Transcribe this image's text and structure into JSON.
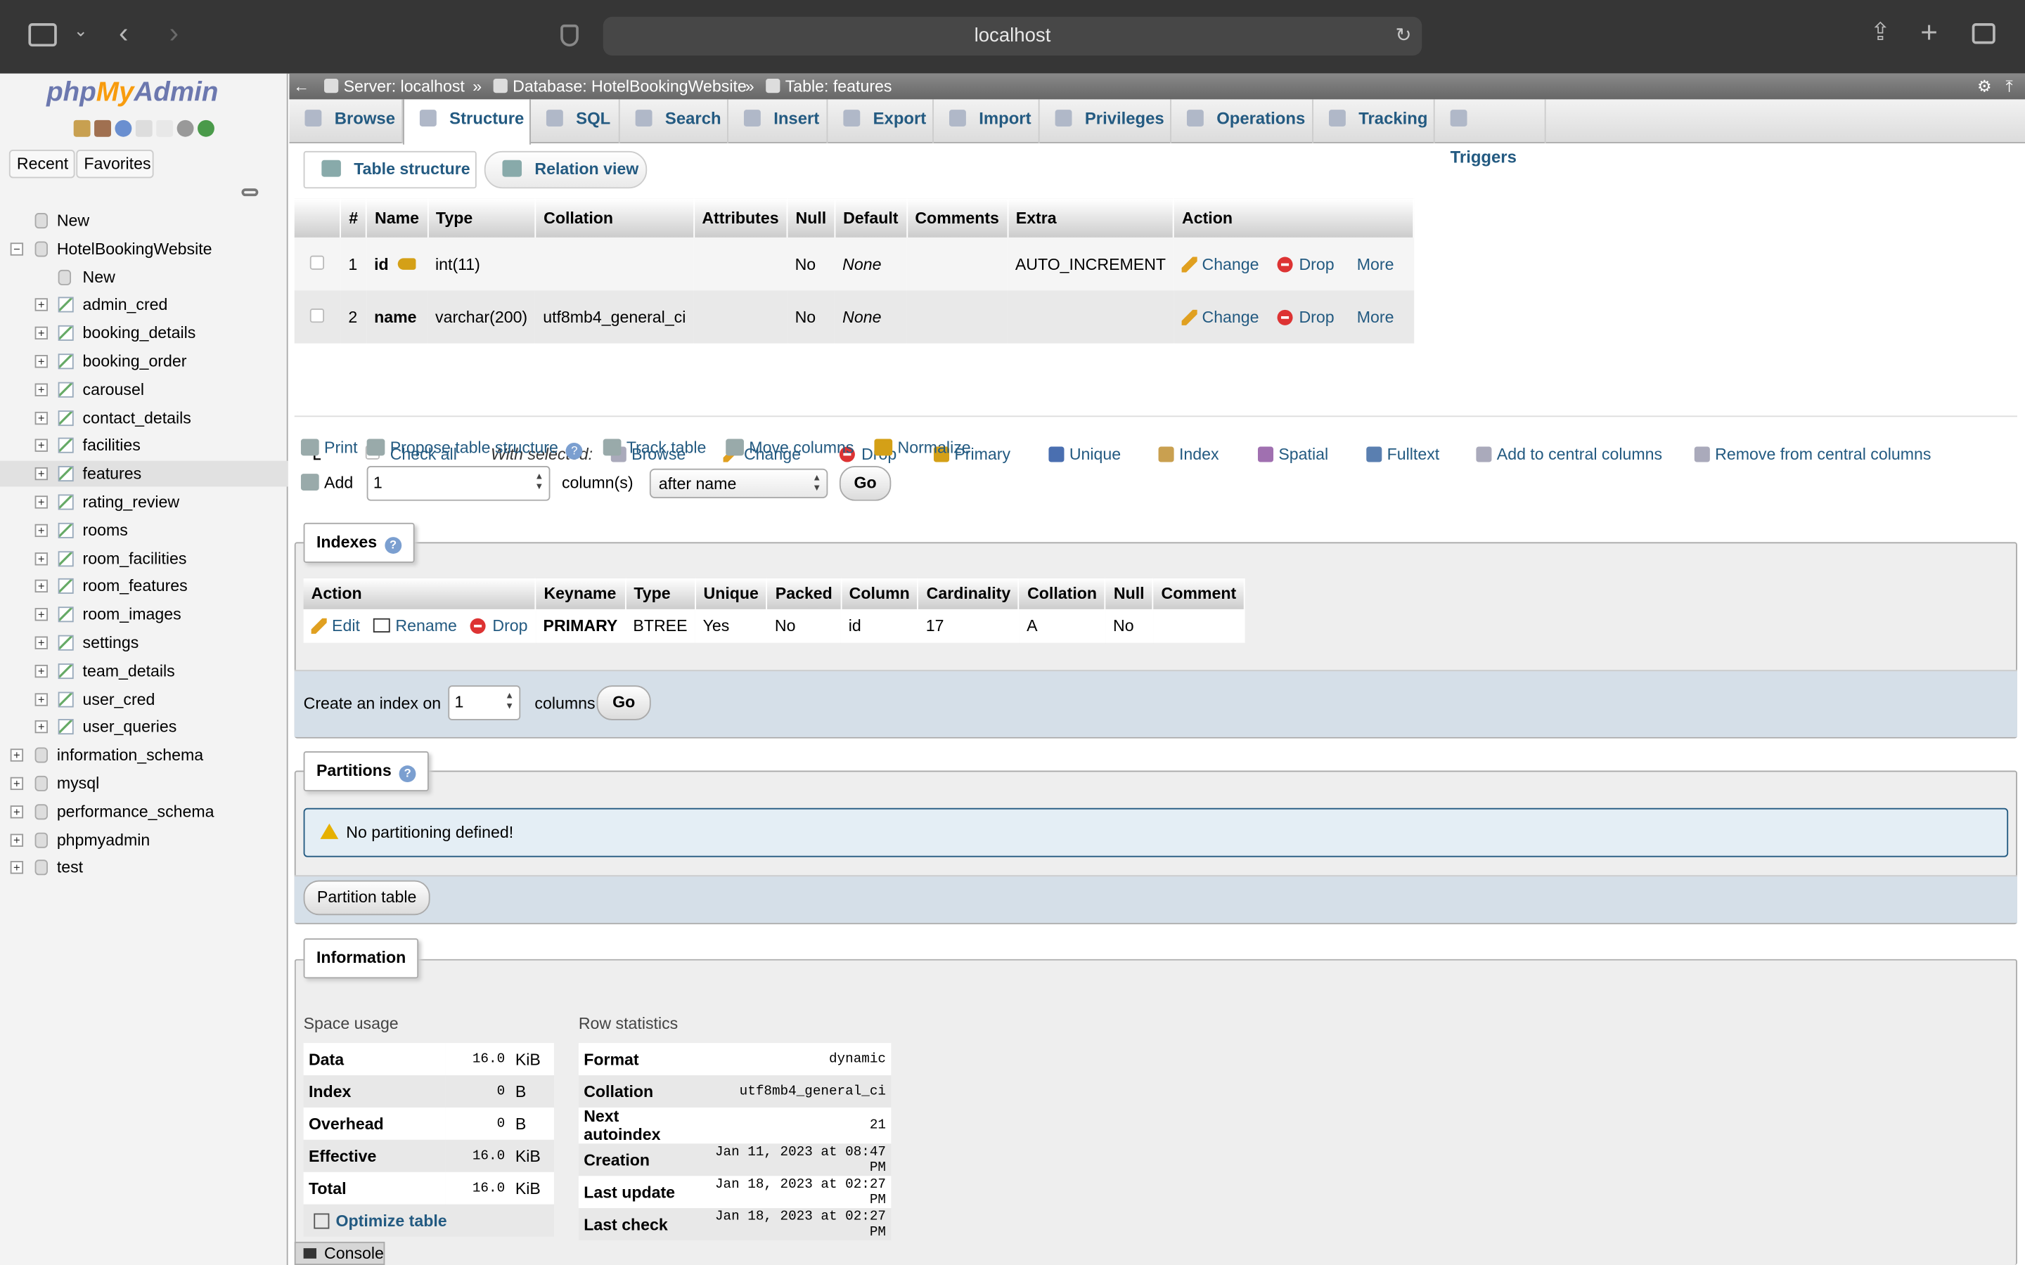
{
  "browser": {
    "url": "localhost"
  },
  "sidebar": {
    "logo_php": "php",
    "logo_my": "My",
    "logo_admin": "Admin",
    "recent": "Recent",
    "favorites": "Favorites",
    "tree": [
      {
        "label": "New",
        "level": 1
      },
      {
        "label": "HotelBookingWebsite",
        "level": 0,
        "expanded": true
      },
      {
        "label": "New",
        "level": 2
      },
      {
        "label": "admin_cred",
        "level": 2
      },
      {
        "label": "booking_details",
        "level": 2
      },
      {
        "label": "booking_order",
        "level": 2
      },
      {
        "label": "carousel",
        "level": 2
      },
      {
        "label": "contact_details",
        "level": 2
      },
      {
        "label": "facilities",
        "level": 2
      },
      {
        "label": "features",
        "level": 2,
        "selected": true
      },
      {
        "label": "rating_review",
        "level": 2
      },
      {
        "label": "rooms",
        "level": 2
      },
      {
        "label": "room_facilities",
        "level": 2
      },
      {
        "label": "room_features",
        "level": 2
      },
      {
        "label": "room_images",
        "level": 2
      },
      {
        "label": "settings",
        "level": 2
      },
      {
        "label": "team_details",
        "level": 2
      },
      {
        "label": "user_cred",
        "level": 2
      },
      {
        "label": "user_queries",
        "level": 2
      },
      {
        "label": "information_schema",
        "level": 0
      },
      {
        "label": "mysql",
        "level": 0
      },
      {
        "label": "performance_schema",
        "level": 0
      },
      {
        "label": "phpmyadmin",
        "level": 0
      },
      {
        "label": "test",
        "level": 0
      }
    ]
  },
  "breadcrumb": {
    "server": "Server: localhost",
    "database": "Database: HotelBookingWebsite",
    "table": "Table: features",
    "sep": "»"
  },
  "tabs": [
    "Browse",
    "Structure",
    "SQL",
    "Search",
    "Insert",
    "Export",
    "Import",
    "Privileges",
    "Operations",
    "Tracking",
    "Triggers"
  ],
  "subtabs": {
    "table_structure": "Table structure",
    "relation_view": "Relation view"
  },
  "structure": {
    "headers": [
      "#",
      "Name",
      "Type",
      "Collation",
      "Attributes",
      "Null",
      "Default",
      "Comments",
      "Extra",
      "Action"
    ],
    "rows": [
      {
        "num": "1",
        "name": "id",
        "type": "int(11)",
        "collation": "",
        "attributes": "",
        "null": "No",
        "default": "None",
        "comments": "",
        "extra": "AUTO_INCREMENT"
      },
      {
        "num": "2",
        "name": "name",
        "type": "varchar(200)",
        "collation": "utf8mb4_general_ci",
        "attributes": "",
        "null": "No",
        "default": "None",
        "comments": "",
        "extra": ""
      }
    ],
    "change": "Change",
    "drop": "Drop",
    "more": "More"
  },
  "with_selected": {
    "check_all": "Check all",
    "label": "With selected:",
    "browse": "Browse",
    "change": "Change",
    "drop": "Drop",
    "primary": "Primary",
    "unique": "Unique",
    "index": "Index",
    "spatial": "Spatial",
    "fulltext": "Fulltext",
    "add_central": "Add to central columns",
    "remove_central": "Remove from central columns"
  },
  "actions": {
    "print": "Print",
    "propose": "Propose table structure",
    "track": "Track table",
    "move": "Move columns",
    "normalize": "Normalize",
    "add": "Add",
    "add_value": "1",
    "columns": "column(s)",
    "position": "after name",
    "go": "Go"
  },
  "indexes": {
    "legend": "Indexes",
    "headers": [
      "Action",
      "Keyname",
      "Type",
      "Unique",
      "Packed",
      "Column",
      "Cardinality",
      "Collation",
      "Null",
      "Comment"
    ],
    "edit": "Edit",
    "rename": "Rename",
    "drop": "Drop",
    "row": {
      "keyname": "PRIMARY",
      "type": "BTREE",
      "unique": "Yes",
      "packed": "No",
      "column": "id",
      "cardinality": "17",
      "collation": "A",
      "null": "No",
      "comment": ""
    },
    "create_label": "Create an index on",
    "create_value": "1",
    "columns": "columns",
    "go": "Go"
  },
  "partitions": {
    "legend": "Partitions",
    "notice": "No partitioning defined!",
    "button": "Partition table"
  },
  "information": {
    "legend": "Information",
    "space_title": "Space usage",
    "space": [
      {
        "label": "Data",
        "value": "16.0",
        "unit": "KiB"
      },
      {
        "label": "Index",
        "value": "0",
        "unit": "B"
      },
      {
        "label": "Overhead",
        "value": "0",
        "unit": "B"
      },
      {
        "label": "Effective",
        "value": "16.0",
        "unit": "KiB"
      },
      {
        "label": "Total",
        "value": "16.0",
        "unit": "KiB"
      }
    ],
    "optimize": "Optimize table",
    "row_title": "Row statistics",
    "rows": [
      {
        "label": "Format",
        "value": "dynamic"
      },
      {
        "label": "Collation",
        "value": "utf8mb4_general_ci"
      },
      {
        "label": "Next autoindex",
        "value": "21"
      },
      {
        "label": "Creation",
        "value": "Jan 11, 2023 at 08:47 PM"
      },
      {
        "label": "Last update",
        "value": "Jan 18, 2023 at 02:27 PM"
      },
      {
        "label": "Last check",
        "value": "Jan 18, 2023 at 02:27 PM"
      }
    ]
  },
  "console": "Console"
}
